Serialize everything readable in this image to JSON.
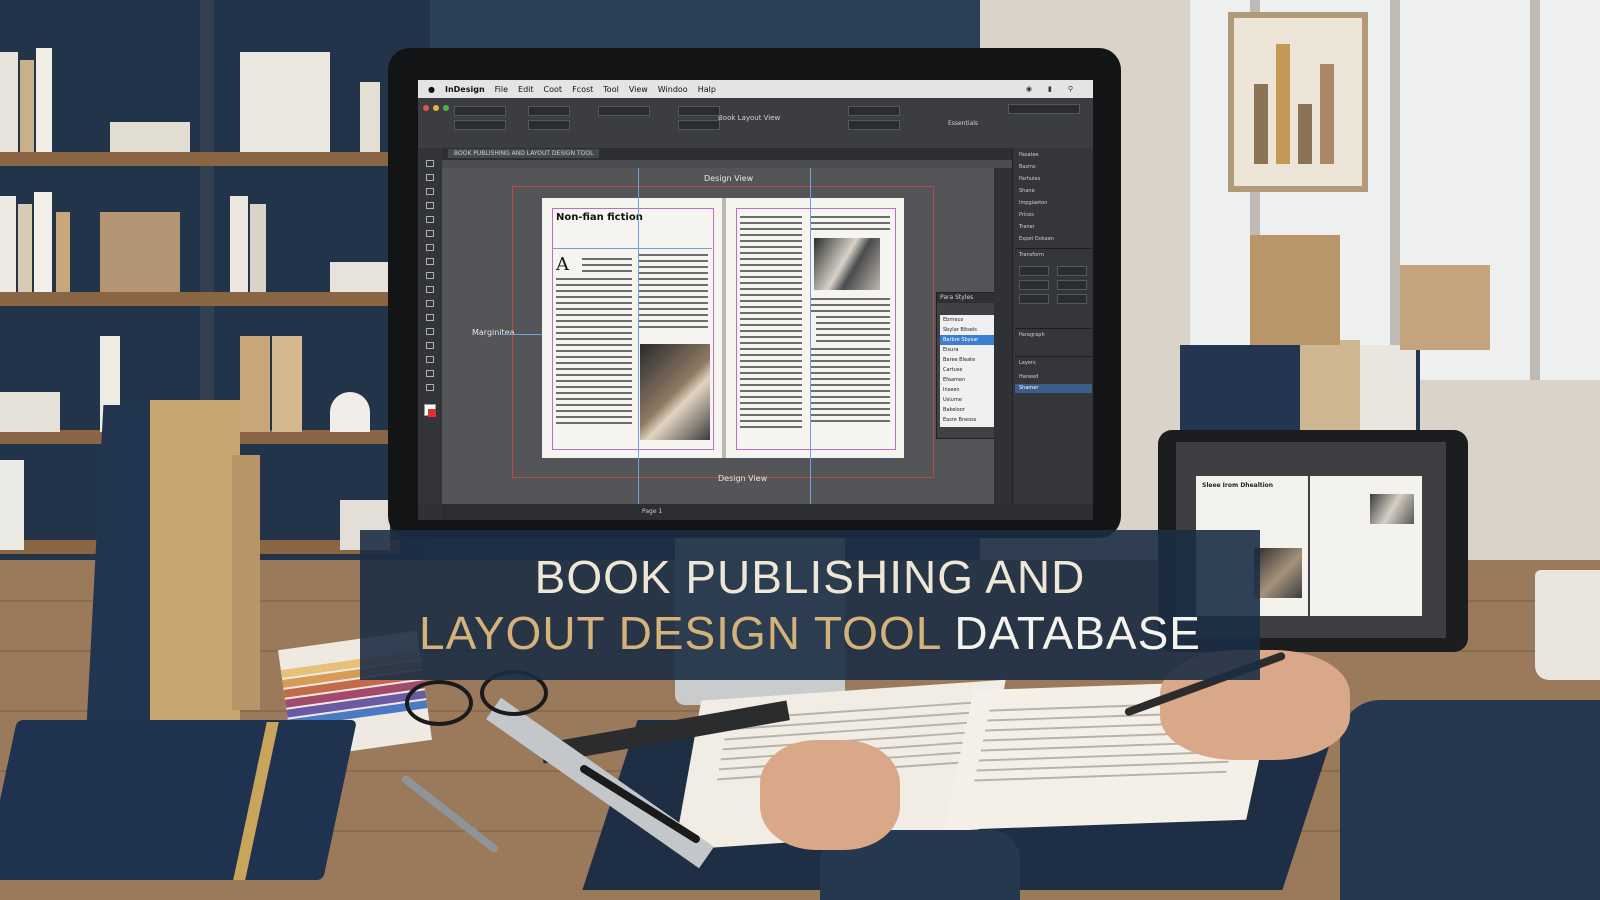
{
  "banner": {
    "line1": "BOOK PUBLISHING AND",
    "line2_part1": "LAYOUT DESIGN TOOL",
    "line2_part2": " DATABASE"
  },
  "app": {
    "menu": {
      "app_name": "InDesign",
      "items": [
        "File",
        "Edit",
        "Coot",
        "Fcost",
        "Tool",
        "View",
        "Windoo",
        "Halp"
      ]
    },
    "window_title": "Book Layout View",
    "workspace": "Essentials",
    "document_tab": "BOOK PUBLISHING AND LAYOUT DESIGN TOOL",
    "canvas": {
      "top_label": "Design View",
      "bottom_label": "Design View",
      "margin_label": "Marginitea",
      "heading": "Non-fian fiction",
      "dropcap": "A"
    },
    "styles_panel": {
      "title": "Para Styles",
      "items": [
        "Ebrneus",
        "Sbylar Bitsels",
        "Barbre Sbysar",
        "Eisura",
        "Baree Bleate",
        "Cartuse",
        "Efaamen",
        "Inseen",
        "Usiume",
        "Bakeloor",
        "Easre Bneoss"
      ],
      "selected_index": 2
    },
    "dock": {
      "pages_items": [
        "Pasatee",
        "Basms",
        "Parhules",
        "Shane",
        "Impgiaeton",
        "Prices",
        "Traner",
        "Expet Dokaen"
      ],
      "transform_title": "Transform",
      "paragraph_title": "Paragraph",
      "layers_title": "Layers",
      "layers": [
        "Haneed",
        "Shamer"
      ]
    },
    "status_text": "Page 1"
  },
  "tablet": {
    "heading": "Sleee Irom Dhealtion"
  },
  "colors": {
    "banner_bg": "#1c2d44",
    "gold": "#d4b27a",
    "selection_blue": "#3b7fd1",
    "guide_blue": "#6ea2d8",
    "margin_magenta": "#b96fc8",
    "bleed_red": "#b84a4a"
  },
  "icons": [
    "apple-icon",
    "wifi-icon",
    "battery-icon",
    "search-icon"
  ]
}
